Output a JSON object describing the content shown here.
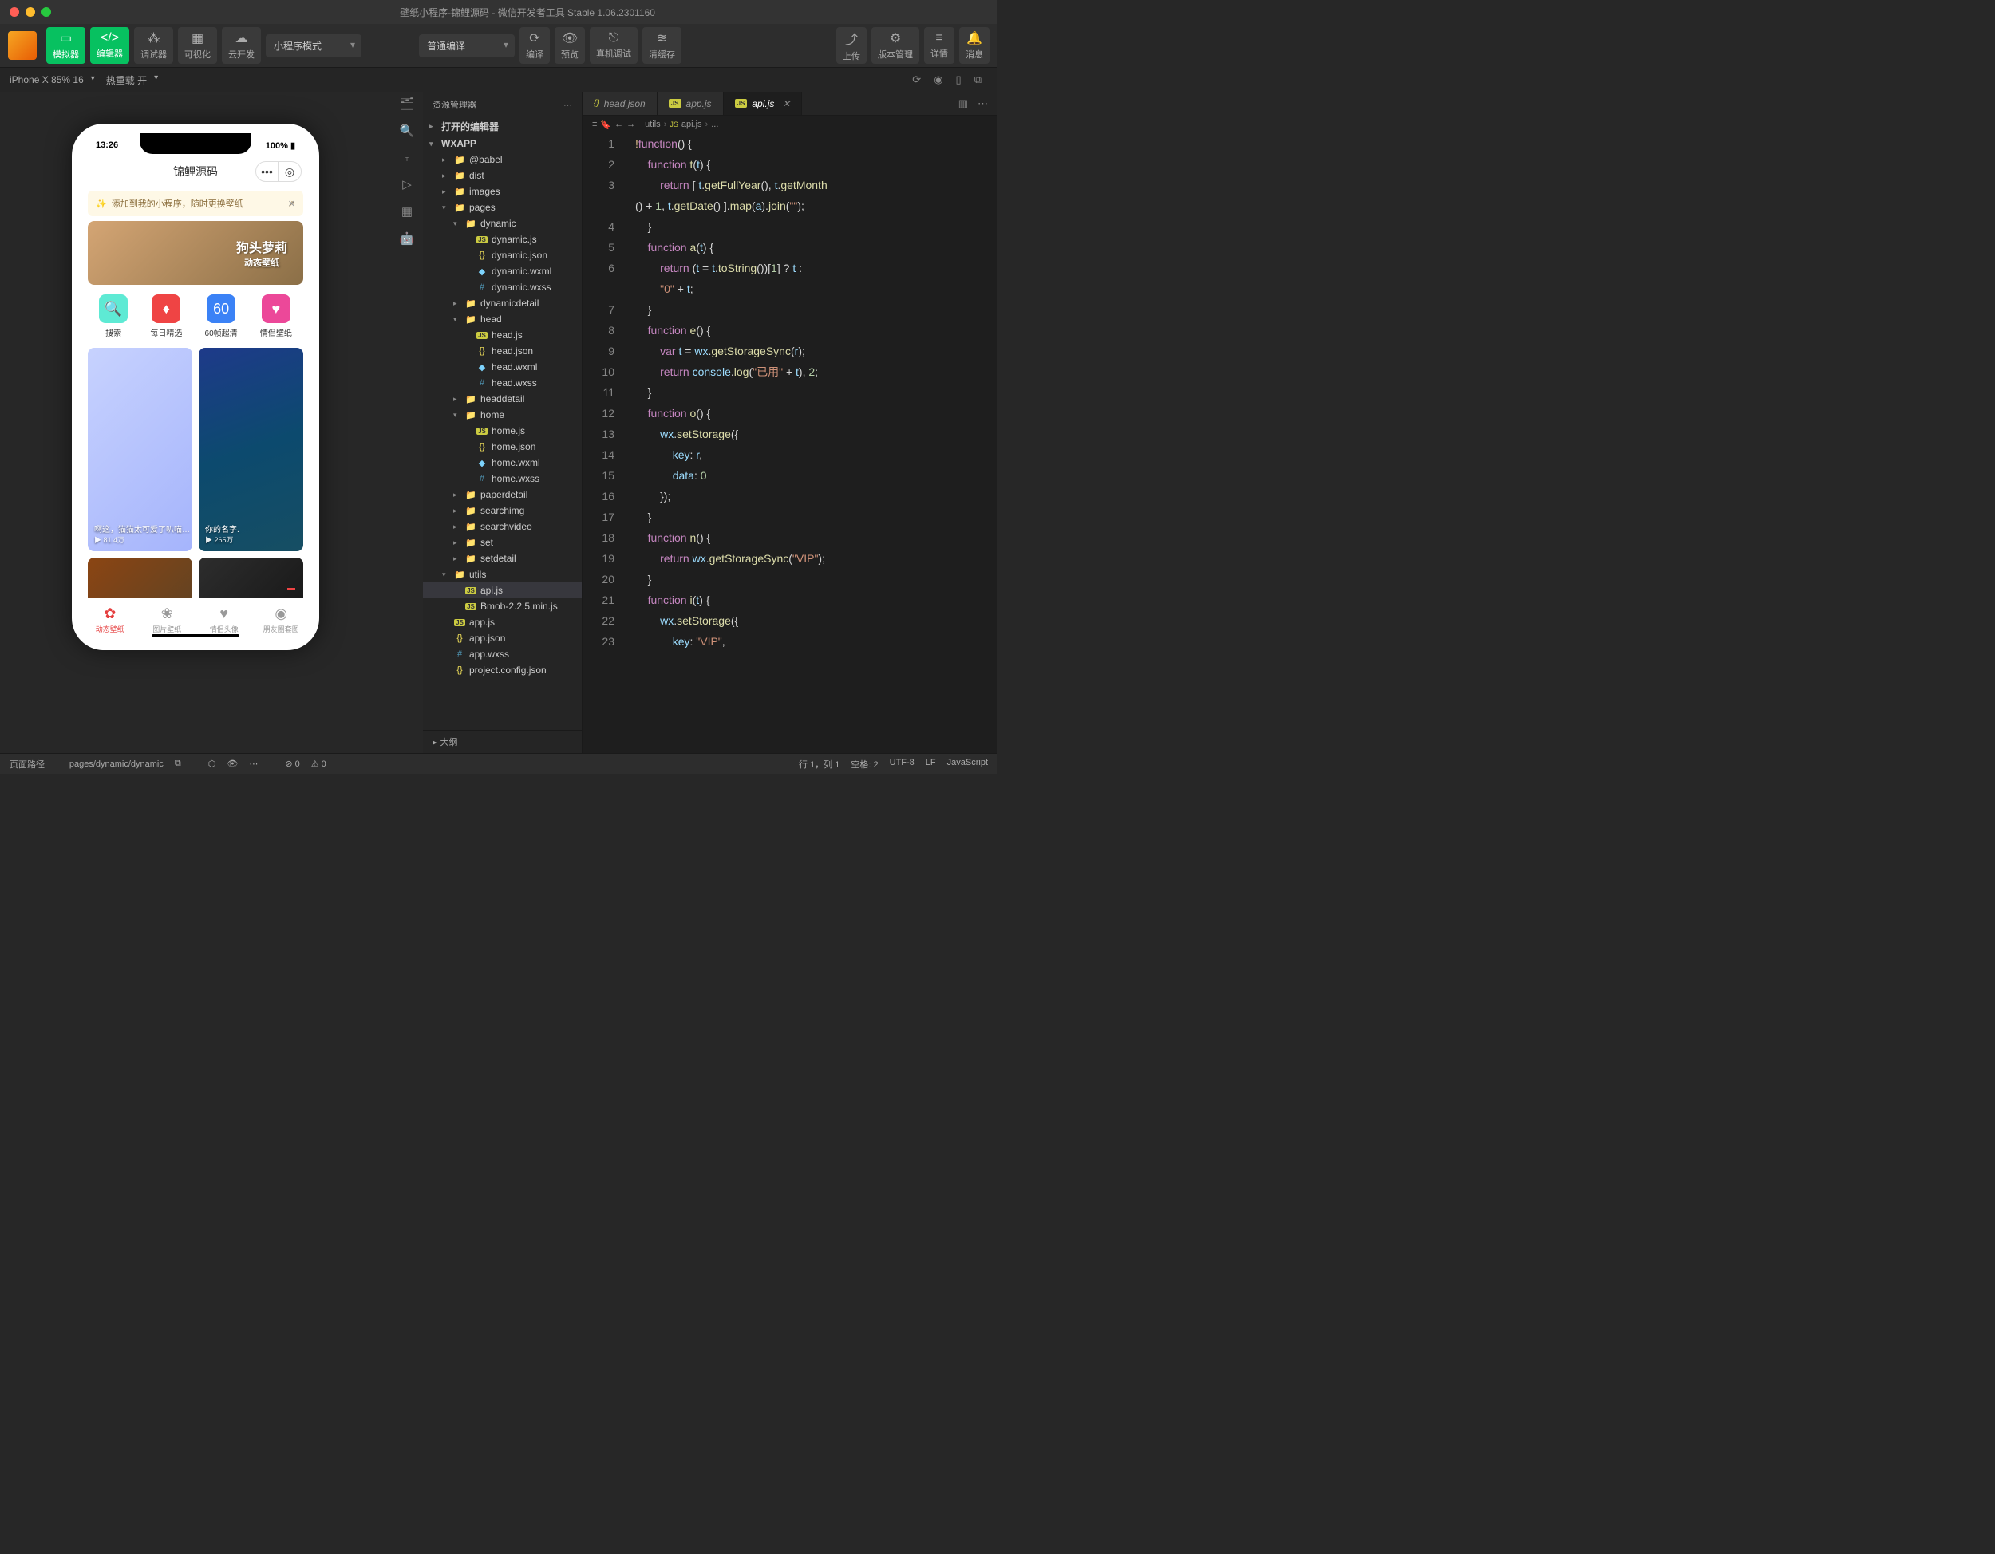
{
  "window": {
    "title": "壁纸小程序-锦鲤源码 - 微信开发者工具 Stable 1.06.2301160"
  },
  "toolbar": {
    "simulator": "模拟器",
    "editor": "编辑器",
    "debugger": "调试器",
    "visual": "可视化",
    "cloud": "云开发",
    "mode": "小程序模式",
    "compile": "普通编译",
    "compile_btn": "编译",
    "preview": "预览",
    "remote": "真机调试",
    "clear": "清缓存",
    "upload": "上传",
    "version": "版本管理",
    "details": "详情",
    "messages": "消息"
  },
  "subbar": {
    "device": "iPhone X 85% 16",
    "hotreload": "热重载 开"
  },
  "simulator": {
    "time": "13:26",
    "battery": "100%",
    "app_title": "锦鲤源码",
    "tip": "添加到我的小程序，随时更换壁纸",
    "hero_title": "狗头萝莉",
    "hero_sub": "动态壁纸",
    "cats": [
      {
        "label": "搜索",
        "ico": "🔍"
      },
      {
        "label": "每日精选",
        "ico": "♦"
      },
      {
        "label": "60帧超清",
        "ico": "60"
      },
      {
        "label": "情侣壁纸",
        "ico": "♥"
      }
    ],
    "card1_title": "啊这，猫猫太可爱了叭喵…",
    "card1_plays": "81.4万",
    "card2_title": "你的名字.",
    "card2_plays": "265万",
    "tabs": [
      {
        "label": "动态壁纸",
        "ico": "✿"
      },
      {
        "label": "图片壁纸",
        "ico": "❀"
      },
      {
        "label": "情侣头像",
        "ico": "♥"
      },
      {
        "label": "朋友圈套图",
        "ico": "◉"
      }
    ]
  },
  "explorer": {
    "title": "资源管理器",
    "outline": "大纲",
    "sections": {
      "open_editors": "打开的编辑器",
      "root": "WXAPP"
    },
    "tree": [
      {
        "name": "@babel",
        "type": "folder",
        "depth": 1,
        "exp": false
      },
      {
        "name": "dist",
        "type": "folder",
        "depth": 1,
        "exp": false,
        "color": "#e06c75"
      },
      {
        "name": "images",
        "type": "folder",
        "depth": 1,
        "exp": false,
        "color": "#4ec9b0"
      },
      {
        "name": "pages",
        "type": "folder",
        "depth": 1,
        "exp": true
      },
      {
        "name": "dynamic",
        "type": "folder",
        "depth": 2,
        "exp": true
      },
      {
        "name": "dynamic.js",
        "type": "js",
        "depth": 3
      },
      {
        "name": "dynamic.json",
        "type": "json",
        "depth": 3
      },
      {
        "name": "dynamic.wxml",
        "type": "wxml",
        "depth": 3
      },
      {
        "name": "dynamic.wxss",
        "type": "wxss",
        "depth": 3
      },
      {
        "name": "dynamicdetail",
        "type": "folder",
        "depth": 2,
        "exp": false
      },
      {
        "name": "head",
        "type": "folder",
        "depth": 2,
        "exp": true
      },
      {
        "name": "head.js",
        "type": "js",
        "depth": 3
      },
      {
        "name": "head.json",
        "type": "json",
        "depth": 3
      },
      {
        "name": "head.wxml",
        "type": "wxml",
        "depth": 3
      },
      {
        "name": "head.wxss",
        "type": "wxss",
        "depth": 3
      },
      {
        "name": "headdetail",
        "type": "folder",
        "depth": 2,
        "exp": false
      },
      {
        "name": "home",
        "type": "folder",
        "depth": 2,
        "exp": true
      },
      {
        "name": "home.js",
        "type": "js",
        "depth": 3
      },
      {
        "name": "home.json",
        "type": "json",
        "depth": 3
      },
      {
        "name": "home.wxml",
        "type": "wxml",
        "depth": 3
      },
      {
        "name": "home.wxss",
        "type": "wxss",
        "depth": 3
      },
      {
        "name": "paperdetail",
        "type": "folder",
        "depth": 2,
        "exp": false
      },
      {
        "name": "searchimg",
        "type": "folder",
        "depth": 2,
        "exp": false
      },
      {
        "name": "searchvideo",
        "type": "folder",
        "depth": 2,
        "exp": false
      },
      {
        "name": "set",
        "type": "folder",
        "depth": 2,
        "exp": false
      },
      {
        "name": "setdetail",
        "type": "folder",
        "depth": 2,
        "exp": false
      },
      {
        "name": "utils",
        "type": "folder",
        "depth": 1,
        "exp": true,
        "color": "#4ec9b0"
      },
      {
        "name": "api.js",
        "type": "js",
        "depth": 2,
        "selected": true
      },
      {
        "name": "Bmob-2.2.5.min.js",
        "type": "js",
        "depth": 2
      },
      {
        "name": "app.js",
        "type": "js",
        "depth": 1
      },
      {
        "name": "app.json",
        "type": "json",
        "depth": 1
      },
      {
        "name": "app.wxss",
        "type": "wxss",
        "depth": 1
      },
      {
        "name": "project.config.json",
        "type": "json",
        "depth": 1
      }
    ]
  },
  "tabs": [
    {
      "name": "head.json",
      "icon": "json",
      "active": false
    },
    {
      "name": "app.js",
      "icon": "js",
      "active": false
    },
    {
      "name": "api.js",
      "icon": "js",
      "active": true
    }
  ],
  "breadcrumb": [
    "utils",
    "api.js",
    "..."
  ],
  "code_lines": [
    {
      "n": 1,
      "html": "<span class='y'>!</span><span class='k'>function</span><span class='p'>() {</span>"
    },
    {
      "n": 2,
      "html": "    <span class='k'>function</span> <span class='fn'>t</span><span class='p'>(</span><span class='v'>t</span><span class='p'>) {</span>"
    },
    {
      "n": 3,
      "html": "        <span class='k'>return</span> <span class='p'>[ </span><span class='v'>t</span><span class='p'>.</span><span class='m'>getFullYear</span><span class='p'>(), </span><span class='v'>t</span><span class='p'>.</span><span class='m'>getMonth</span>"
    },
    {
      "n": "",
      "html": "<span class='p'>() + </span><span class='n'>1</span><span class='p'>, </span><span class='v'>t</span><span class='p'>.</span><span class='m'>getDate</span><span class='p'>() ].</span><span class='m'>map</span><span class='p'>(</span><span class='v'>a</span><span class='p'>).</span><span class='m'>join</span><span class='p'>(</span><span class='s'>\"\"</span><span class='p'>);</span>"
    },
    {
      "n": 4,
      "html": "    <span class='p'>}</span>"
    },
    {
      "n": 5,
      "html": "    <span class='k'>function</span> <span class='fn'>a</span><span class='p'>(</span><span class='v'>t</span><span class='p'>) {</span>"
    },
    {
      "n": 6,
      "html": "        <span class='k'>return</span> <span class='p'>(</span><span class='v'>t</span> <span class='p'>=</span> <span class='v'>t</span><span class='p'>.</span><span class='m'>toString</span><span class='p'>())[</span><span class='n'>1</span><span class='p'>] ? </span><span class='v'>t</span><span class='p'> :</span>"
    },
    {
      "n": "",
      "html": "        <span class='s'>\"0\"</span> <span class='p'>+</span> <span class='v'>t</span><span class='p'>;</span>"
    },
    {
      "n": 7,
      "html": "    <span class='p'>}</span>"
    },
    {
      "n": 8,
      "html": "    <span class='k'>function</span> <span class='fn'>e</span><span class='p'>() {</span>"
    },
    {
      "n": 9,
      "html": "        <span class='k'>var</span> <span class='v'>t</span> <span class='p'>=</span> <span class='v'>wx</span><span class='p'>.</span><span class='m'>getStorageSync</span><span class='p'>(</span><span class='v'>r</span><span class='p'>);</span>"
    },
    {
      "n": 10,
      "html": "        <span class='k'>return</span> <span class='v'>console</span><span class='p'>.</span><span class='m'>log</span><span class='p'>(</span><span class='s'>\"已用\"</span> <span class='p'>+</span> <span class='v'>t</span><span class='p'>), </span><span class='n'>2</span><span class='p'>;</span>"
    },
    {
      "n": 11,
      "html": "    <span class='p'>}</span>"
    },
    {
      "n": 12,
      "html": "    <span class='k'>function</span> <span class='fn'>o</span><span class='p'>() {</span>"
    },
    {
      "n": 13,
      "html": "        <span class='v'>wx</span><span class='p'>.</span><span class='m'>setStorage</span><span class='p'>({</span>"
    },
    {
      "n": 14,
      "html": "            <span class='v'>key</span><span class='p'>: </span><span class='v'>r</span><span class='p'>,</span>"
    },
    {
      "n": 15,
      "html": "            <span class='v'>data</span><span class='p'>: </span><span class='n'>0</span>"
    },
    {
      "n": 16,
      "html": "        <span class='p'>});</span>"
    },
    {
      "n": 17,
      "html": "    <span class='p'>}</span>"
    },
    {
      "n": 18,
      "html": "    <span class='k'>function</span> <span class='fn'>n</span><span class='p'>() {</span>"
    },
    {
      "n": 19,
      "html": "        <span class='k'>return</span> <span class='v'>wx</span><span class='p'>.</span><span class='m'>getStorageSync</span><span class='p'>(</span><span class='s'>\"VIP\"</span><span class='p'>);</span>"
    },
    {
      "n": 20,
      "html": "    <span class='p'>}</span>"
    },
    {
      "n": 21,
      "html": "    <span class='k'>function</span> <span class='fn'>i</span><span class='p'>(</span><span class='v'>t</span><span class='p'>) {</span>"
    },
    {
      "n": 22,
      "html": "        <span class='v'>wx</span><span class='p'>.</span><span class='m'>setStorage</span><span class='p'>({</span>"
    },
    {
      "n": 23,
      "html": "            <span class='v'>key</span><span class='p'>: </span><span class='s'>\"VIP\"</span><span class='p'>,</span>"
    }
  ],
  "status": {
    "path_label": "页面路径",
    "path": "pages/dynamic/dynamic",
    "errors": "0",
    "warnings": "0",
    "line_col": "行 1，列 1",
    "spaces": "空格: 2",
    "encoding": "UTF-8",
    "eol": "LF",
    "lang": "JavaScript"
  }
}
